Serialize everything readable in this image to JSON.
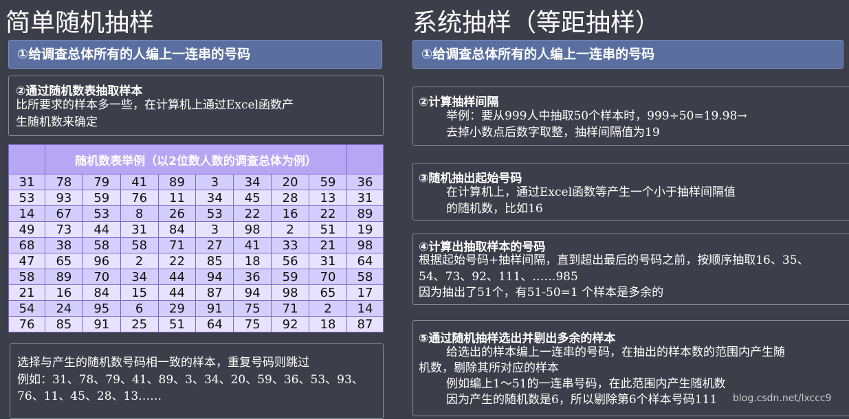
{
  "left": {
    "title": "简单随机抽样",
    "step1": "①给调查总体所有的人编上一连串的号码",
    "step2_title": "②通过随机数表抽取样本",
    "step2_lines": [
      "比所要求的样本多一些，在计算机上通过Excel函数产",
      "生随机数来确定"
    ],
    "table_header": "随机数表举例（以2位数人数的调查总体为例）",
    "table_rows": [
      [
        "31",
        "78",
        "79",
        "41",
        "89",
        "3",
        "34",
        "20",
        "59",
        "36"
      ],
      [
        "53",
        "93",
        "59",
        "76",
        "11",
        "34",
        "45",
        "28",
        "13",
        "31"
      ],
      [
        "14",
        "67",
        "53",
        "8",
        "26",
        "53",
        "22",
        "16",
        "22",
        "89"
      ],
      [
        "49",
        "73",
        "44",
        "31",
        "84",
        "3",
        "98",
        "2",
        "51",
        "19"
      ],
      [
        "68",
        "38",
        "58",
        "58",
        "71",
        "27",
        "41",
        "33",
        "21",
        "98"
      ],
      [
        "47",
        "65",
        "96",
        "2",
        "22",
        "85",
        "18",
        "56",
        "31",
        "64"
      ],
      [
        "58",
        "89",
        "70",
        "34",
        "44",
        "94",
        "36",
        "59",
        "70",
        "58"
      ],
      [
        "21",
        "16",
        "84",
        "15",
        "44",
        "87",
        "94",
        "98",
        "65",
        "17"
      ],
      [
        "54",
        "24",
        "95",
        "6",
        "29",
        "91",
        "75",
        "71",
        "2",
        "14"
      ],
      [
        "76",
        "85",
        "91",
        "25",
        "51",
        "64",
        "75",
        "92",
        "18",
        "87"
      ]
    ],
    "bottom_lines": [
      "选择与产生的随机数号码相一致的样本，重复号码则跳过",
      "例如：31、78、79、41、89、3、34、20、59、36、53、93、",
      "76、11、45、28、13……"
    ]
  },
  "right": {
    "title": "系统抽样（等距抽样）",
    "step1": "①给调查总体所有的人编上一连串的号码",
    "step2_title": "②计算抽样间隔",
    "step2_lines": [
      "举例：要从999人中抽取50个样本时，999÷50=19.98→",
      "去掉小数点后数字取整，抽样间隔值为19"
    ],
    "step3_title": "③随机抽出起始号码",
    "step3_lines": [
      "在计算机上，通过Excel函数等产生一个小于抽样间隔值",
      "的随机数，比如16"
    ],
    "step4_title": "④计算出抽取样本的号码",
    "step4_lines": [
      "根据起始号码+抽样间隔，直到超出最后的号码之前，按顺序抽取16、35、",
      "54、73、92、111、……985",
      "因为抽出了51个，有51-50=1 个样本是多余的"
    ],
    "step5_title": "⑤通过随机抽样选出并剔出多余的样本",
    "step5_lines": [
      "给选出的样本编上一连串的号码，在抽出的样本数的范围内产生随",
      "机数，剔除其所对应的样本",
      "例如编上1～51的一连串号码，在此范围内产生随机数",
      "因为产生的随机数是6，所以剔除第6个样本号码111"
    ]
  },
  "watermark": "blog.csdn.net/lxccc9"
}
